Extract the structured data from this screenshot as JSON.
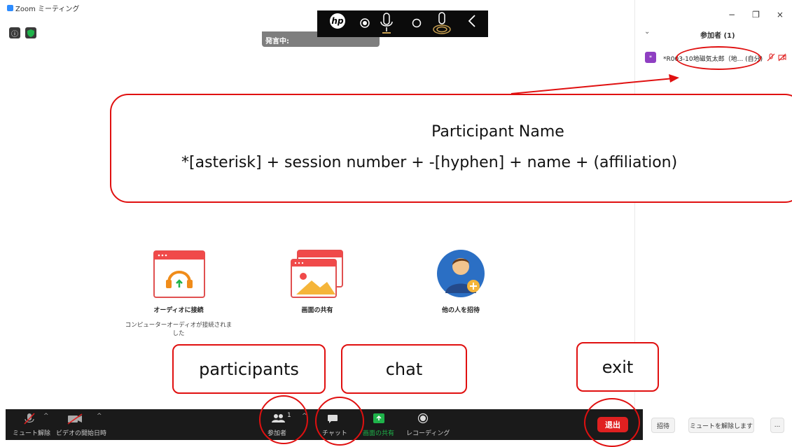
{
  "window": {
    "app_title": "Zoom ミーティング",
    "min_label": "−",
    "max_label": "❐",
    "close_label": "×"
  },
  "meeting": {
    "info_icon": "info-icon",
    "security_icon": "shield-icon",
    "speaking_label": "発言中:"
  },
  "hp_toolbar": {
    "logo_text": "hp",
    "icons": [
      "record-dot-icon",
      "mic-icon",
      "circle-icon",
      "mic-wave-icon",
      "chevron-left-icon"
    ]
  },
  "participants_panel": {
    "title": "参加者 (1)",
    "collapse_icon": "chevron-down-icon",
    "participant": {
      "avatar_text": "*",
      "name": "*R003-10地磁気太郎（地... (自分)",
      "avatar_color": "#8f3fc2"
    }
  },
  "callout": {
    "line1": "Participant Name",
    "line2": "*[asterisk] + session number + -[hyphen] + name + (affiliation)"
  },
  "tiles": [
    {
      "label": "オーディオに接続",
      "sublabel": "コンピューターオーディオが接続されました"
    },
    {
      "label": "画面の共有",
      "sublabel": ""
    },
    {
      "label": "他の人を招待",
      "sublabel": ""
    }
  ],
  "annotations": {
    "participants": "participants",
    "chat": "chat",
    "exit": "exit"
  },
  "toolbar": {
    "unmute_label": "ミュート解除",
    "start_video_label": "ビデオの開始日時",
    "participants_label": "参加者",
    "participants_count": "1",
    "chat_label": "チャット",
    "share_label": "画面の共有",
    "record_label": "レコーディング",
    "leave_label": "退出"
  },
  "panel_buttons": {
    "invite_label": "招待",
    "unmute_all_label": "ミュートを解除します",
    "more_label": "..."
  },
  "colors": {
    "accent_red": "#e01010",
    "zoom_blue": "#2d8cff",
    "share_green": "#1fb34a",
    "toolbar_bg": "#1a1a1a"
  }
}
